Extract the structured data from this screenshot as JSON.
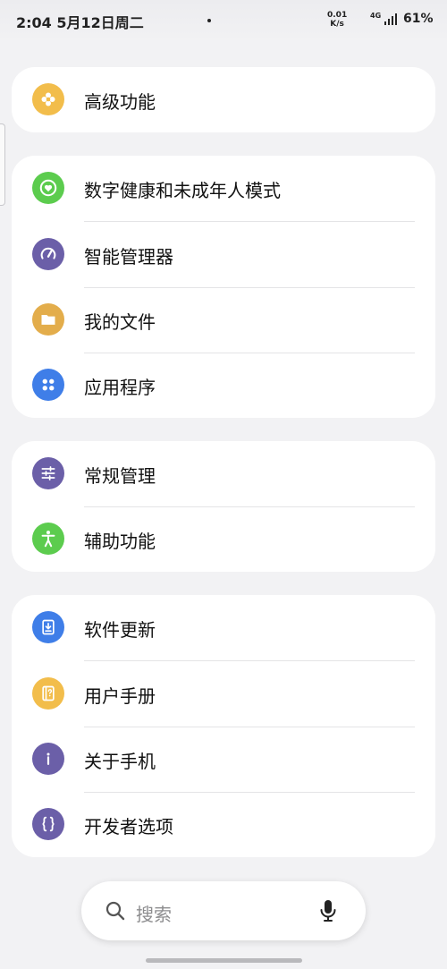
{
  "status_bar": {
    "time_date": "2:04  5月12日周二",
    "net_speed_value": "0.01",
    "net_speed_unit": "K/s",
    "network": "4G",
    "battery": "61%"
  },
  "settings": {
    "group1": [
      {
        "label": "高级功能",
        "icon": "gear-icon",
        "color": "#f2bd4b"
      }
    ],
    "group2": [
      {
        "label": "数字健康和未成年人模式",
        "icon": "heart-circle-icon",
        "color": "#5ccc4e"
      },
      {
        "label": "智能管理器",
        "icon": "speedometer-icon",
        "color": "#6b5fa8"
      },
      {
        "label": "我的文件",
        "icon": "folder-icon",
        "color": "#e3ad4b"
      },
      {
        "label": "应用程序",
        "icon": "apps-grid-icon",
        "color": "#3f7ee8"
      }
    ],
    "group3": [
      {
        "label": "常规管理",
        "icon": "sliders-icon",
        "color": "#6b5fa8"
      },
      {
        "label": "辅助功能",
        "icon": "accessibility-icon",
        "color": "#5ccc4e"
      }
    ],
    "group4": [
      {
        "label": "软件更新",
        "icon": "download-icon",
        "color": "#3f7ee8"
      },
      {
        "label": "用户手册",
        "icon": "manual-icon",
        "color": "#f2bd4b"
      },
      {
        "label": "关于手机",
        "icon": "info-icon",
        "color": "#6b5fa8"
      },
      {
        "label": "开发者选项",
        "icon": "braces-icon",
        "color": "#6b5fa8"
      }
    ]
  },
  "search": {
    "placeholder": "搜索",
    "search_icon": "search-icon",
    "mic_icon": "microphone-icon"
  }
}
